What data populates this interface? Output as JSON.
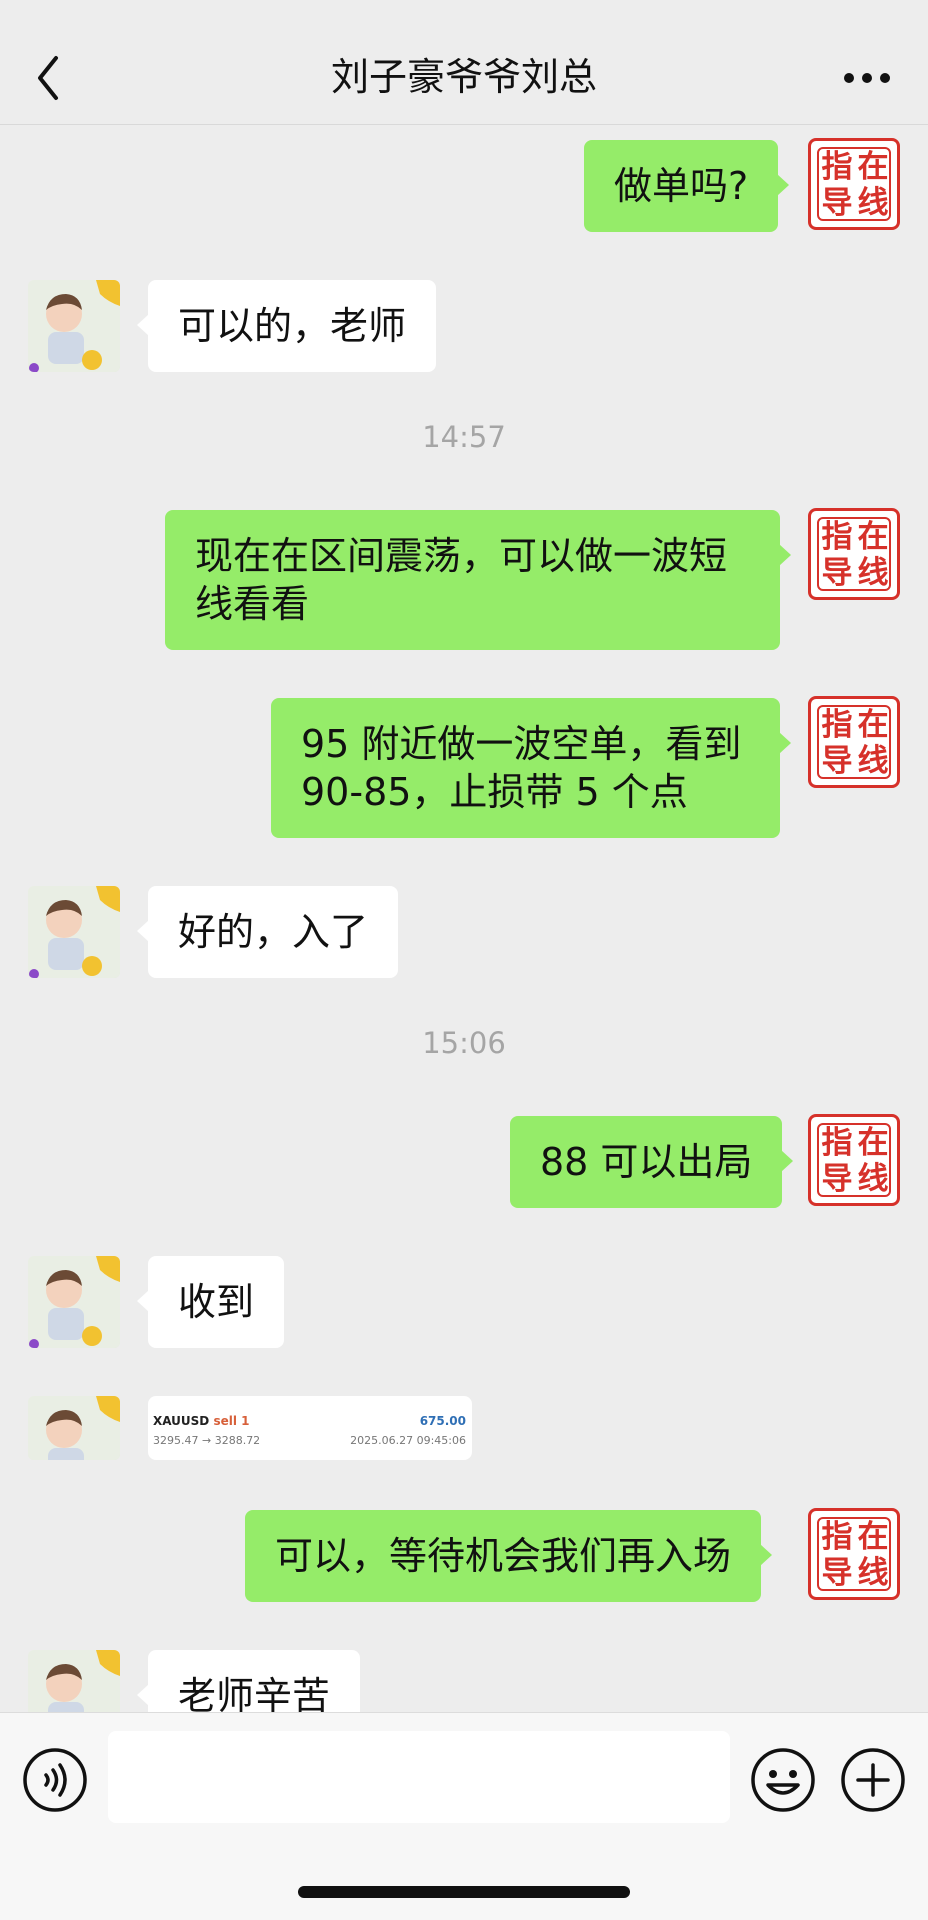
{
  "header": {
    "title": "刘子豪爷爷刘总",
    "back_icon": "chevron-left-icon",
    "more_icon": "more-horizontal-icon"
  },
  "my_avatar": {
    "seal_chars": [
      "指",
      "在",
      "导",
      "线"
    ],
    "color": "#d6312a"
  },
  "messages": {
    "m1": "做单吗?",
    "m2": "可以的，老师",
    "t1": "14:57",
    "m3": "现在在区间震荡，可以做一波短线看看",
    "m4": "95 附近做一波空单，看到 90-85，止损带 5 个点",
    "m5": "好的，入了",
    "t2": "15:06",
    "m6": "88 可以出局",
    "m7": "收到",
    "m9": "可以，等待机会我们再入场",
    "m10": "老师辛苦"
  },
  "trade_card": {
    "symbol": "XAUUSD",
    "side": "sell 1",
    "profit": "675.00",
    "prices": "3295.47 → 3288.72",
    "timestamp": "2025.06.27 09:45:06"
  },
  "input_bar": {
    "placeholder": "",
    "voice_icon": "voice-icon",
    "emoji_icon": "emoji-icon",
    "plus_icon": "plus-icon"
  },
  "colors": {
    "background": "#ededed",
    "my_bubble": "#95ec69",
    "other_bubble": "#ffffff",
    "timestamp": "#a5a5a5",
    "seal_red": "#d6312a"
  }
}
